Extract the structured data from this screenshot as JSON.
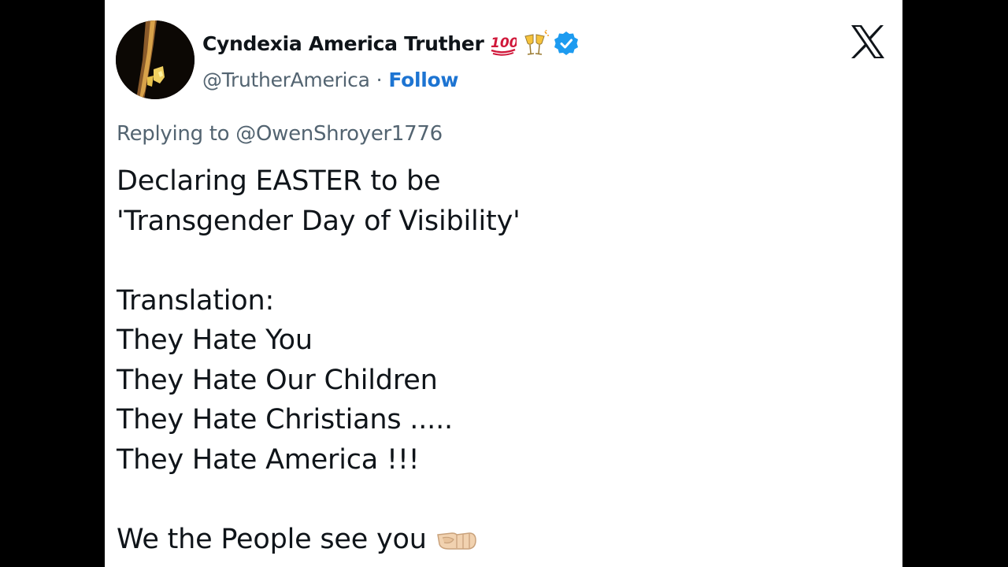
{
  "tweet": {
    "author": {
      "display_name": "Cyndexia America Truther",
      "name_emojis": [
        "hundred-points-emoji",
        "clinking-glasses-emoji"
      ],
      "verified": true,
      "handle": "@TrutherAmerica",
      "separator": "·",
      "follow_label": "Follow"
    },
    "platform_icon": "x-logo-icon",
    "replying_prefix": "Replying to",
    "replying_to": "@OwenShroyer1776",
    "lines": [
      "Declaring EASTER to be",
      "'Transgender Day of Visibility'",
      "",
      "Translation:",
      "They Hate You",
      "They Hate Our Children",
      "They Hate Christians .....",
      "They Hate America !!!",
      "",
      "We the People see you"
    ],
    "trailing_emoji": "left-facing-fist-emoji",
    "colors": {
      "text": "#0f1419",
      "secondary": "#536471",
      "link": "#1d74d2",
      "verified": "#1d9bf0",
      "background": "#ffffff",
      "letterbox": "#000000"
    }
  }
}
